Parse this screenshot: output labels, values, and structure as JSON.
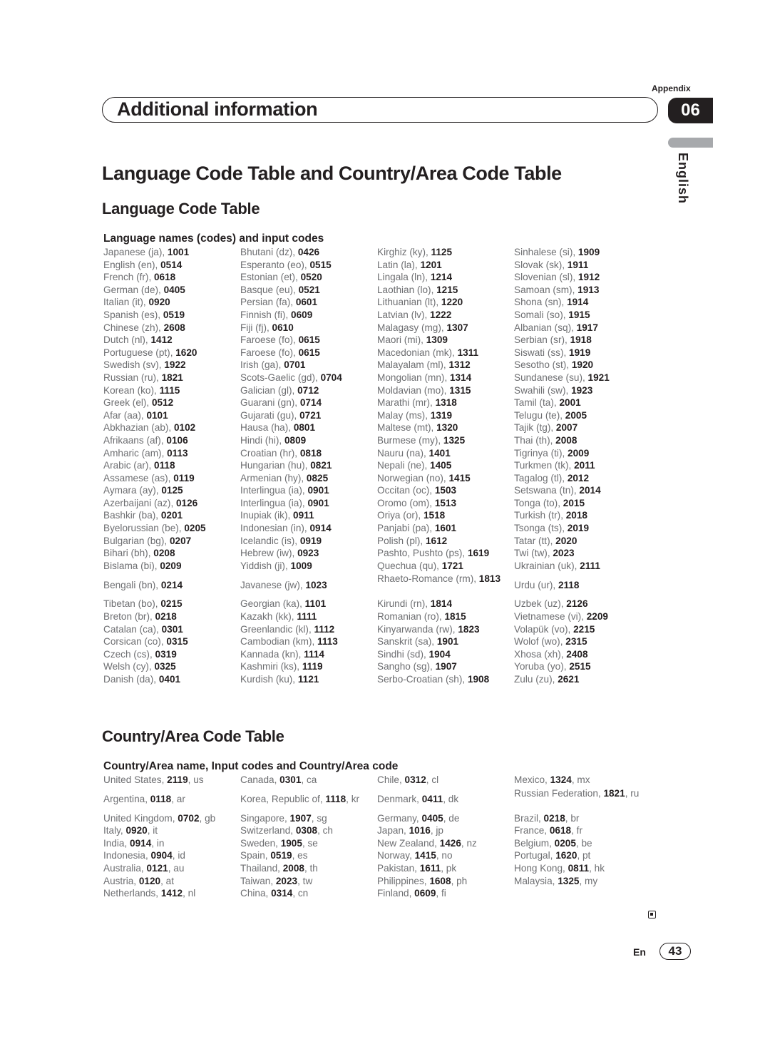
{
  "header": {
    "appendix_label": "Appendix",
    "section_title": "Additional information",
    "chapter_number": "06",
    "language_tab": "English"
  },
  "main_title": "Language Code Table and Country/Area Code Table",
  "language_table": {
    "heading": "Language Code Table",
    "caption": "Language names (codes) and input codes",
    "rows": [
      [
        {
          "name": "Japanese (ja), ",
          "code": "1001"
        },
        {
          "name": "Bhutani (dz), ",
          "code": "0426"
        },
        {
          "name": "Kirghiz (ky), ",
          "code": "1125"
        },
        {
          "name": "Sinhalese (si), ",
          "code": "1909"
        }
      ],
      [
        {
          "name": "English (en), ",
          "code": "0514"
        },
        {
          "name": "Esperanto (eo), ",
          "code": "0515"
        },
        {
          "name": "Latin (la), ",
          "code": "1201"
        },
        {
          "name": "Slovak (sk), ",
          "code": "1911"
        }
      ],
      [
        {
          "name": "French (fr), ",
          "code": "0618"
        },
        {
          "name": "Estonian (et), ",
          "code": "0520"
        },
        {
          "name": "Lingala (ln), ",
          "code": "1214"
        },
        {
          "name": "Slovenian (sl), ",
          "code": "1912"
        }
      ],
      [
        {
          "name": "German (de), ",
          "code": "0405"
        },
        {
          "name": "Basque (eu), ",
          "code": "0521"
        },
        {
          "name": "Laothian (lo), ",
          "code": "1215"
        },
        {
          "name": "Samoan (sm), ",
          "code": "1913"
        }
      ],
      [
        {
          "name": "Italian (it), ",
          "code": "0920"
        },
        {
          "name": "Persian (fa), ",
          "code": "0601"
        },
        {
          "name": "Lithuanian (lt), ",
          "code": "1220"
        },
        {
          "name": "Shona (sn), ",
          "code": "1914"
        }
      ],
      [
        {
          "name": "Spanish (es), ",
          "code": "0519"
        },
        {
          "name": "Finnish (fi), ",
          "code": "0609"
        },
        {
          "name": "Latvian (lv), ",
          "code": "1222"
        },
        {
          "name": "Somali (so), ",
          "code": "1915"
        }
      ],
      [
        {
          "name": "Chinese (zh), ",
          "code": "2608"
        },
        {
          "name": "Fiji (fj), ",
          "code": "0610"
        },
        {
          "name": "Malagasy (mg), ",
          "code": "1307"
        },
        {
          "name": "Albanian (sq), ",
          "code": "1917"
        }
      ],
      [
        {
          "name": "Dutch (nl), ",
          "code": "1412"
        },
        {
          "name": "Faroese (fo), ",
          "code": "0615"
        },
        {
          "name": "Maori (mi), ",
          "code": "1309"
        },
        {
          "name": "Serbian (sr), ",
          "code": "1918"
        }
      ],
      [
        {
          "name": "Portuguese (pt), ",
          "code": "1620"
        },
        {
          "name": "Faroese (fo), ",
          "code": "0615"
        },
        {
          "name": "Macedonian (mk), ",
          "code": "1311"
        },
        {
          "name": "Siswati (ss), ",
          "code": "1919"
        }
      ],
      [
        {
          "name": "Swedish (sv), ",
          "code": "1922"
        },
        {
          "name": "Irish (ga), ",
          "code": "0701"
        },
        {
          "name": "Malayalam (ml), ",
          "code": "1312"
        },
        {
          "name": "Sesotho (st), ",
          "code": "1920"
        }
      ],
      [
        {
          "name": "Russian (ru), ",
          "code": "1821"
        },
        {
          "name": "Scots-Gaelic (gd), ",
          "code": "0704"
        },
        {
          "name": "Mongolian (mn), ",
          "code": "1314"
        },
        {
          "name": "Sundanese (su), ",
          "code": "1921"
        }
      ],
      [
        {
          "name": "Korean (ko), ",
          "code": "1115"
        },
        {
          "name": "Galician (gl), ",
          "code": "0712"
        },
        {
          "name": "Moldavian (mo), ",
          "code": "1315"
        },
        {
          "name": "Swahili (sw), ",
          "code": "1923"
        }
      ],
      [
        {
          "name": "Greek (el), ",
          "code": "0512"
        },
        {
          "name": "Guarani (gn), ",
          "code": "0714"
        },
        {
          "name": "Marathi (mr), ",
          "code": "1318"
        },
        {
          "name": "Tamil (ta), ",
          "code": "2001"
        }
      ],
      [
        {
          "name": "Afar (aa), ",
          "code": "0101"
        },
        {
          "name": "Gujarati (gu), ",
          "code": "0721"
        },
        {
          "name": "Malay (ms), ",
          "code": "1319"
        },
        {
          "name": "Telugu (te), ",
          "code": "2005"
        }
      ],
      [
        {
          "name": "Abkhazian (ab), ",
          "code": "0102"
        },
        {
          "name": "Hausa (ha), ",
          "code": "0801"
        },
        {
          "name": "Maltese (mt), ",
          "code": "1320"
        },
        {
          "name": "Tajik (tg), ",
          "code": "2007"
        }
      ],
      [
        {
          "name": "Afrikaans (af), ",
          "code": "0106"
        },
        {
          "name": "Hindi (hi), ",
          "code": "0809"
        },
        {
          "name": "Burmese (my), ",
          "code": "1325"
        },
        {
          "name": "Thai (th), ",
          "code": "2008"
        }
      ],
      [
        {
          "name": "Amharic (am), ",
          "code": "0113"
        },
        {
          "name": "Croatian (hr), ",
          "code": "0818"
        },
        {
          "name": "Nauru (na), ",
          "code": "1401"
        },
        {
          "name": "Tigrinya (ti), ",
          "code": "2009"
        }
      ],
      [
        {
          "name": "Arabic (ar), ",
          "code": "0118"
        },
        {
          "name": "Hungarian (hu), ",
          "code": "0821"
        },
        {
          "name": "Nepali (ne), ",
          "code": "1405"
        },
        {
          "name": "Turkmen (tk), ",
          "code": "2011"
        }
      ],
      [
        {
          "name": "Assamese (as), ",
          "code": "0119"
        },
        {
          "name": "Armenian (hy), ",
          "code": "0825"
        },
        {
          "name": "Norwegian (no), ",
          "code": "1415"
        },
        {
          "name": "Tagalog (tl), ",
          "code": "2012"
        }
      ],
      [
        {
          "name": "Aymara (ay), ",
          "code": "0125"
        },
        {
          "name": "Interlingua (ia), ",
          "code": "0901"
        },
        {
          "name": "Occitan (oc), ",
          "code": "1503"
        },
        {
          "name": "Setswana (tn), ",
          "code": "2014"
        }
      ],
      [
        {
          "name": "Azerbaijani (az), ",
          "code": "0126"
        },
        {
          "name": "Interlingua (ia), ",
          "code": "0901"
        },
        {
          "name": "Oromo (om), ",
          "code": "1513"
        },
        {
          "name": "Tonga (to), ",
          "code": "2015"
        }
      ],
      [
        {
          "name": "Bashkir (ba), ",
          "code": "0201"
        },
        {
          "name": "Inupiak (ik), ",
          "code": "0911"
        },
        {
          "name": "Oriya (or), ",
          "code": "1518"
        },
        {
          "name": "Turkish (tr), ",
          "code": "2018"
        }
      ],
      [
        {
          "name": "Byelorussian (be), ",
          "code": "0205"
        },
        {
          "name": "Indonesian (in), ",
          "code": "0914"
        },
        {
          "name": "Panjabi (pa), ",
          "code": "1601"
        },
        {
          "name": "Tsonga (ts), ",
          "code": "2019"
        }
      ],
      [
        {
          "name": "Bulgarian (bg), ",
          "code": "0207"
        },
        {
          "name": "Icelandic (is), ",
          "code": "0919"
        },
        {
          "name": "Polish (pl), ",
          "code": "1612"
        },
        {
          "name": "Tatar (tt), ",
          "code": "2020"
        }
      ],
      [
        {
          "name": "Bihari (bh), ",
          "code": "0208"
        },
        {
          "name": "Hebrew (iw), ",
          "code": "0923"
        },
        {
          "name": "Pashto, Pushto (ps), ",
          "code": "1619"
        },
        {
          "name": "Twi (tw), ",
          "code": "2023"
        }
      ],
      [
        {
          "name": "Bislama (bi), ",
          "code": "0209"
        },
        {
          "name": "Yiddish (ji), ",
          "code": "1009"
        },
        {
          "name": "Quechua (qu), ",
          "code": "1721"
        },
        {
          "name": "Ukrainian (uk), ",
          "code": "2111"
        }
      ],
      [
        {
          "name": "Bengali (bn), ",
          "code": "0214"
        },
        {
          "name": "Javanese (jw), ",
          "code": "1023"
        },
        {
          "name": "Rhaeto-Romance (rm), ",
          "code": "1813"
        },
        {
          "name": "Urdu (ur), ",
          "code": "2118"
        }
      ],
      [
        {
          "name": "Tibetan (bo), ",
          "code": "0215"
        },
        {
          "name": "Georgian (ka), ",
          "code": "1101"
        },
        {
          "name": "Kirundi (rn), ",
          "code": "1814"
        },
        {
          "name": "Uzbek (uz), ",
          "code": "2126"
        }
      ],
      [
        {
          "name": "Breton (br), ",
          "code": "0218"
        },
        {
          "name": "Kazakh (kk), ",
          "code": "1111"
        },
        {
          "name": "Romanian (ro), ",
          "code": "1815"
        },
        {
          "name": "Vietnamese (vi), ",
          "code": "2209"
        }
      ],
      [
        {
          "name": "Catalan (ca), ",
          "code": "0301"
        },
        {
          "name": "Greenlandic (kl), ",
          "code": "1112"
        },
        {
          "name": "Kinyarwanda (rw), ",
          "code": "1823"
        },
        {
          "name": "Volapük (vo), ",
          "code": "2215"
        }
      ],
      [
        {
          "name": "Corsican (co), ",
          "code": "0315"
        },
        {
          "name": "Cambodian (km), ",
          "code": "1113"
        },
        {
          "name": "Sanskrit (sa), ",
          "code": "1901"
        },
        {
          "name": "Wolof (wo), ",
          "code": "2315"
        }
      ],
      [
        {
          "name": "Czech (cs), ",
          "code": "0319"
        },
        {
          "name": "Kannada (kn), ",
          "code": "1114"
        },
        {
          "name": "Sindhi (sd), ",
          "code": "1904"
        },
        {
          "name": "Xhosa (xh), ",
          "code": "2408"
        }
      ],
      [
        {
          "name": "Welsh (cy), ",
          "code": "0325"
        },
        {
          "name": "Kashmiri (ks), ",
          "code": "1119"
        },
        {
          "name": "Sangho (sg), ",
          "code": "1907"
        },
        {
          "name": "Yoruba (yo), ",
          "code": "2515"
        }
      ],
      [
        {
          "name": "Danish (da), ",
          "code": "0401"
        },
        {
          "name": "Kurdish (ku), ",
          "code": "1121"
        },
        {
          "name": "Serbo-Croatian (sh), ",
          "code": "1908"
        },
        {
          "name": "Zulu (zu), ",
          "code": "2621"
        }
      ]
    ]
  },
  "country_table": {
    "heading": "Country/Area Code Table",
    "caption": "Country/Area name, Input codes and Country/Area code",
    "rows": [
      [
        {
          "name": "United States, ",
          "code": "2119",
          "abbr": ", us"
        },
        {
          "name": "Canada, ",
          "code": "0301",
          "abbr": ", ca"
        },
        {
          "name": "Chile, ",
          "code": "0312",
          "abbr": ", cl"
        },
        {
          "name": "Mexico, ",
          "code": "1324",
          "abbr": ", mx"
        }
      ],
      [
        {
          "name": "Argentina, ",
          "code": "0118",
          "abbr": ", ar"
        },
        {
          "name": "Korea, Republic of, ",
          "code": "1118",
          "abbr": ", kr"
        },
        {
          "name": "Denmark, ",
          "code": "0411",
          "abbr": ", dk"
        },
        {
          "name": "Russian Federation, ",
          "code": "1821",
          "abbr": ", ru"
        }
      ],
      [
        {
          "name": "United Kingdom, ",
          "code": "0702",
          "abbr": ", gb"
        },
        {
          "name": "Singapore, ",
          "code": "1907",
          "abbr": ", sg"
        },
        {
          "name": "Germany, ",
          "code": "0405",
          "abbr": ", de"
        },
        {
          "name": "Brazil, ",
          "code": "0218",
          "abbr": ", br"
        }
      ],
      [
        {
          "name": "Italy, ",
          "code": "0920",
          "abbr": ", it"
        },
        {
          "name": "Switzerland, ",
          "code": "0308",
          "abbr": ", ch"
        },
        {
          "name": "Japan, ",
          "code": "1016",
          "abbr": ", jp"
        },
        {
          "name": "France, ",
          "code": "0618",
          "abbr": ", fr"
        }
      ],
      [
        {
          "name": "India, ",
          "code": "0914",
          "abbr": ", in"
        },
        {
          "name": "Sweden, ",
          "code": "1905",
          "abbr": ", se"
        },
        {
          "name": "New Zealand, ",
          "code": "1426",
          "abbr": ", nz"
        },
        {
          "name": "Belgium, ",
          "code": "0205",
          "abbr": ", be"
        }
      ],
      [
        {
          "name": "Indonesia, ",
          "code": "0904",
          "abbr": ", id"
        },
        {
          "name": "Spain, ",
          "code": "0519",
          "abbr": ", es"
        },
        {
          "name": "Norway, ",
          "code": "1415",
          "abbr": ", no"
        },
        {
          "name": "Portugal, ",
          "code": "1620",
          "abbr": ", pt"
        }
      ],
      [
        {
          "name": "Australia, ",
          "code": "0121",
          "abbr": ", au"
        },
        {
          "name": "Thailand, ",
          "code": "2008",
          "abbr": ", th"
        },
        {
          "name": "Pakistan, ",
          "code": "1611",
          "abbr": ", pk"
        },
        {
          "name": "Hong Kong, ",
          "code": "0811",
          "abbr": ", hk"
        }
      ],
      [
        {
          "name": "Austria, ",
          "code": "0120",
          "abbr": ", at"
        },
        {
          "name": "Taiwan, ",
          "code": "2023",
          "abbr": ", tw"
        },
        {
          "name": "Philippines, ",
          "code": "1608",
          "abbr": ", ph"
        },
        {
          "name": "Malaysia, ",
          "code": "1325",
          "abbr": ", my"
        }
      ],
      [
        {
          "name": "Netherlands, ",
          "code": "1412",
          "abbr": ", nl"
        },
        {
          "name": "China, ",
          "code": "0314",
          "abbr": ", cn"
        },
        {
          "name": "Finland, ",
          "code": "0609",
          "abbr": ", fi"
        },
        {
          "name": "",
          "code": "",
          "abbr": ""
        }
      ]
    ]
  },
  "footer": {
    "language": "En",
    "page_number": "43"
  }
}
